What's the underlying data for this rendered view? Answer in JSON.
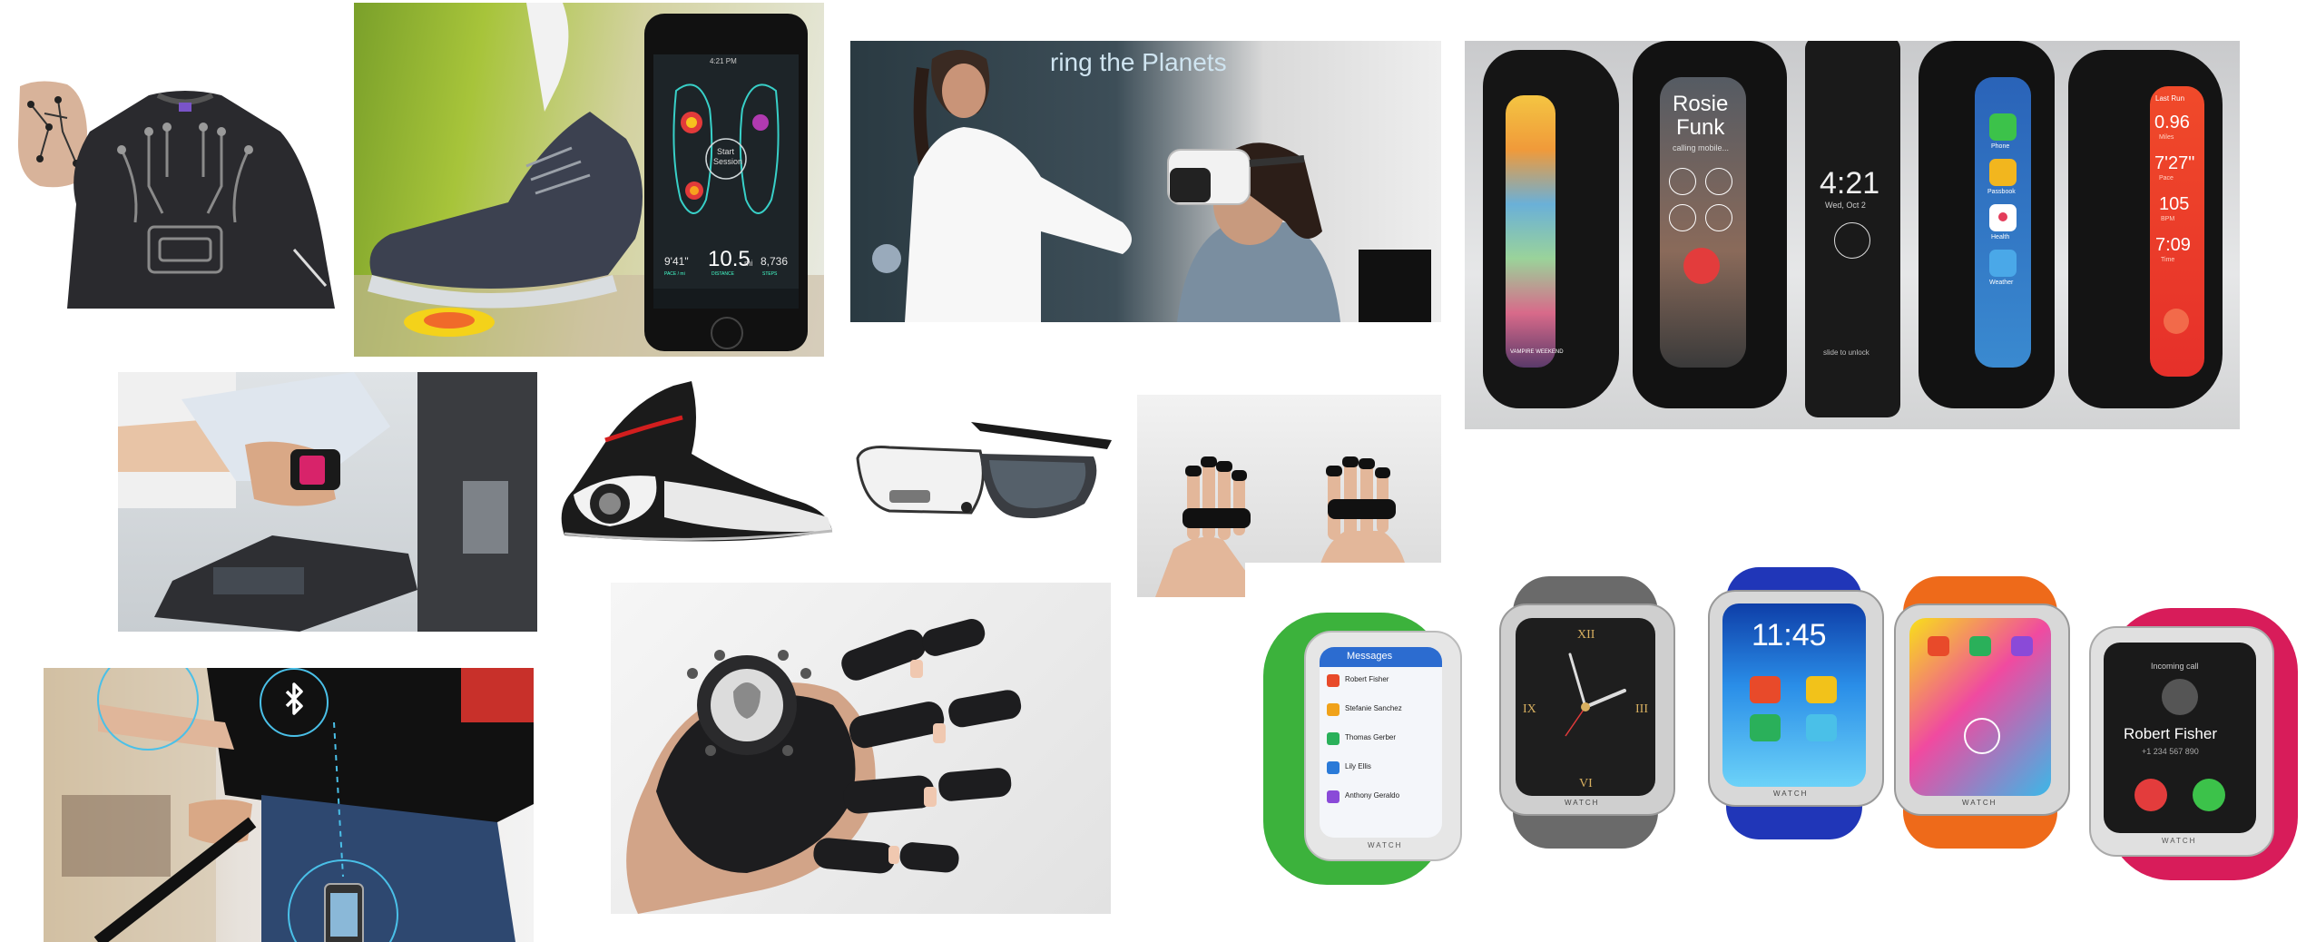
{
  "panels": [
    {
      "name": "smart-shirt",
      "caption": ""
    },
    {
      "name": "smart-insole-app",
      "caption": ""
    },
    {
      "name": "vr-headset",
      "caption": ""
    },
    {
      "name": "curved-smart-bands",
      "caption": ""
    },
    {
      "name": "wrist-payment",
      "caption": ""
    },
    {
      "name": "smart-shoe",
      "caption": ""
    },
    {
      "name": "smart-glasses",
      "caption": ""
    },
    {
      "name": "finger-wearables",
      "caption": ""
    },
    {
      "name": "bluetooth-cane",
      "caption": ""
    },
    {
      "name": "robotic-glove",
      "caption": ""
    },
    {
      "name": "smartwatches",
      "caption": ""
    }
  ],
  "insole_app": {
    "status_time": "4:21 PM",
    "session_label_1": "Start",
    "session_label_2": "Session",
    "stat_main": "10.5",
    "stat_main_unit": "mi",
    "stat_left": "9'41\"",
    "stat_right": "8,736",
    "stat_left_caption": "PACE / mi",
    "stat_mid_caption": "DISTANCE",
    "stat_right_caption": "STEPS"
  },
  "vr_screen": {
    "text": "ring the Planets"
  },
  "bands": {
    "caller_name_1": "Rosie",
    "caller_name_2": "Funk",
    "caller_sub": "calling mobile...",
    "clock_time": "4:21",
    "clock_date": "Wed, Oct 2",
    "unlock_hint": "slide to unlock",
    "apps": [
      "Phone",
      "Passbook",
      "Health",
      "Weather"
    ],
    "run_title": "Last Run",
    "run_stats": [
      "0.96",
      "7'27\"",
      "105",
      "7:09"
    ],
    "run_stat_labels": [
      "Miles",
      "Pace",
      "BPM",
      "Time"
    ],
    "vampire_label": "VAMPIRE WEEKEND"
  },
  "watches": {
    "brand": "WATCH",
    "messages_title": "Messages",
    "message_rows": [
      "Robert Fisher",
      "Stefanie Sanchez",
      "Thomas Gerber",
      "Lily Ellis",
      "Anthony Geraldo"
    ],
    "clock_time": "11:45",
    "caller": "Robert Fisher",
    "caller_status": "Incoming call",
    "caller_number": "+1 234 567 890"
  },
  "colors": {
    "green_band": "#3cb23c",
    "gray_band": "#6a6a6a",
    "blue_band": "#2036b8",
    "orange_band": "#ee6a1a",
    "pink_band": "#d81c5a"
  }
}
